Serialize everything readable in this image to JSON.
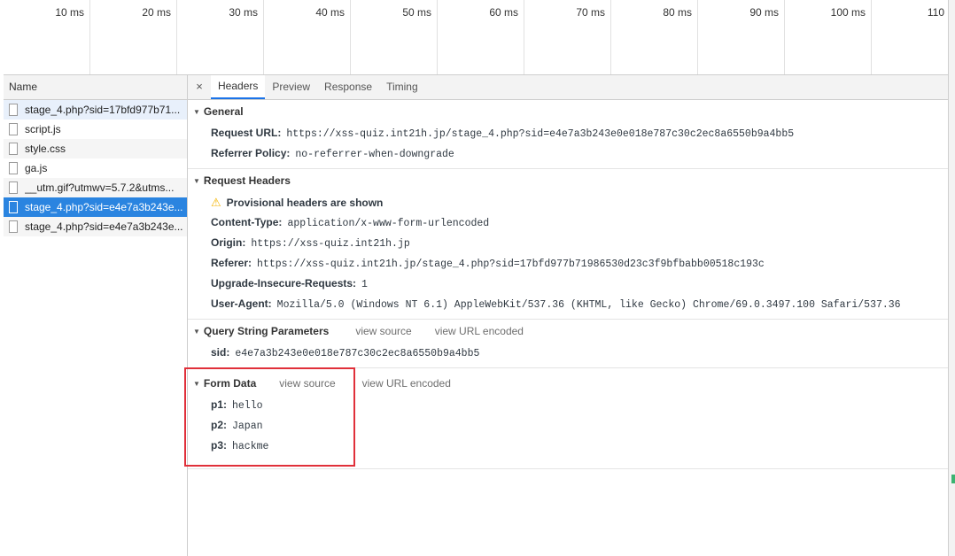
{
  "timeline": {
    "ticks": [
      "10 ms",
      "20 ms",
      "30 ms",
      "40 ms",
      "50 ms",
      "60 ms",
      "70 ms",
      "80 ms",
      "90 ms",
      "100 ms",
      "110"
    ]
  },
  "requests": {
    "header": "Name",
    "items": [
      "stage_4.php?sid=17bfd977b71...",
      "script.js",
      "style.css",
      "ga.js",
      "__utm.gif?utmwv=5.7.2&utms...",
      "stage_4.php?sid=e4e7a3b243e...",
      "stage_4.php?sid=e4e7a3b243e..."
    ]
  },
  "tabs": {
    "close": "×",
    "items": [
      "Headers",
      "Preview",
      "Response",
      "Timing"
    ]
  },
  "general": {
    "title": "General",
    "request_url_key": "Request URL:",
    "request_url": "https://xss-quiz.int21h.jp/stage_4.php?sid=e4e7a3b243e0e018e787c30c2ec8a6550b9a4bb5",
    "referrer_policy_key": "Referrer Policy:",
    "referrer_policy": "no-referrer-when-downgrade"
  },
  "request_headers": {
    "title": "Request Headers",
    "warning": "Provisional headers are shown",
    "content_type_key": "Content-Type:",
    "content_type": "application/x-www-form-urlencoded",
    "origin_key": "Origin:",
    "origin": "https://xss-quiz.int21h.jp",
    "referer_key": "Referer:",
    "referer": "https://xss-quiz.int21h.jp/stage_4.php?sid=17bfd977b71986530d23c3f9bfbabb00518c193c",
    "upgrade_key": "Upgrade-Insecure-Requests:",
    "upgrade": "1",
    "user_agent_key": "User-Agent:",
    "user_agent": "Mozilla/5.0 (Windows NT 6.1) AppleWebKit/537.36 (KHTML, like Gecko) Chrome/69.0.3497.100 Safari/537.36"
  },
  "query_params": {
    "title": "Query String Parameters",
    "view_source": "view source",
    "view_url_encoded": "view URL encoded",
    "sid_key": "sid:",
    "sid": "e4e7a3b243e0e018e787c30c2ec8a6550b9a4bb5"
  },
  "form_data": {
    "title": "Form Data",
    "view_source": "view source",
    "view_url_encoded": "view URL encoded",
    "p1_key": "p1:",
    "p1": "hello",
    "p2_key": "p2:",
    "p2": "Japan",
    "p3_key": "p3:",
    "p3": "hackme"
  },
  "colors": {
    "selected_row": "#2a84e0",
    "highlight_box": "#e0303a",
    "warning": "#f4b400"
  }
}
